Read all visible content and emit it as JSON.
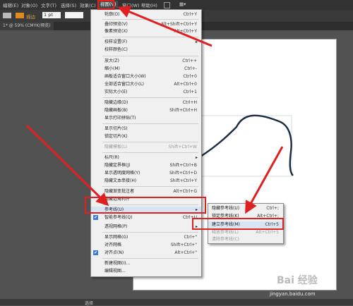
{
  "menubar": {
    "items": [
      "编辑(E)",
      "对象(O)",
      "文字(T)",
      "选择(S)",
      "效果(C)",
      "视图(V)",
      "窗口(W)",
      "帮助(H)"
    ]
  },
  "toolbar": {
    "stroke_label": "描边",
    "stroke_value": "1 pt"
  },
  "tab": {
    "label": "1* @ 59% (CMYK/预览)"
  },
  "view_menu": {
    "items": [
      {
        "label": "轮廓(O)",
        "shortcut": "Ctrl+Y"
      },
      {
        "label": "叠印预览(V)",
        "shortcut": "Alt+Shift+Ctrl+Y"
      },
      {
        "label": "像素预览(X)",
        "shortcut": "Alt+Ctrl+Y"
      },
      {
        "label": "校样设置(F)",
        "shortcut": ""
      },
      {
        "label": "校样颜色(C)",
        "shortcut": ""
      },
      {
        "label": "放大(Z)",
        "shortcut": "Ctrl++"
      },
      {
        "label": "缩小(M)",
        "shortcut": "Ctrl+-"
      },
      {
        "label": "画板适合窗口大小(W)",
        "shortcut": "Ctrl+0"
      },
      {
        "label": "全部适合窗口大小(L)",
        "shortcut": "Alt+Ctrl+0"
      },
      {
        "label": "实际大小(E)",
        "shortcut": "Ctrl+1"
      },
      {
        "label": "隐藏边缘(D)",
        "shortcut": "Ctrl+H"
      },
      {
        "label": "隐藏画板(B)",
        "shortcut": "Shift+Ctrl+H"
      },
      {
        "label": "显示打印拼贴(T)",
        "shortcut": ""
      },
      {
        "label": "显示切片(S)",
        "shortcut": ""
      },
      {
        "label": "锁定切片(K)",
        "shortcut": ""
      },
      {
        "label": "隐藏模板(L)",
        "shortcut": "Shift+Ctrl+W"
      },
      {
        "label": "标尺(R)",
        "shortcut": ""
      },
      {
        "label": "隐藏定界框(J)",
        "shortcut": "Shift+Ctrl+B"
      },
      {
        "label": "显示透明度网格(Y)",
        "shortcut": "Shift+Ctrl+D"
      },
      {
        "label": "隐藏文本串接(H)",
        "shortcut": "Shift+Ctrl+Y"
      },
      {
        "label": "隐藏渐变批注者",
        "shortcut": "Alt+Ctrl+G"
      },
      {
        "label": "隐藏边角构件",
        "shortcut": ""
      },
      {
        "label": "参考线(U)",
        "shortcut": ""
      },
      {
        "label": "智能参考线(Q)",
        "shortcut": "Ctrl+U"
      },
      {
        "label": "透视网格(P)",
        "shortcut": ""
      },
      {
        "label": "显示网格(G)",
        "shortcut": "Ctrl+\""
      },
      {
        "label": "对齐网格",
        "shortcut": "Shift+Ctrl+\""
      },
      {
        "label": "对齐点(N)",
        "shortcut": "Alt+Ctrl+\""
      },
      {
        "label": "新建视图(I)...",
        "shortcut": ""
      },
      {
        "label": "编辑视图...",
        "shortcut": ""
      }
    ]
  },
  "guides_submenu": {
    "items": [
      {
        "label": "隐藏参考线(U)",
        "shortcut": "Ctrl+;"
      },
      {
        "label": "锁定参考线(K)",
        "shortcut": "Alt+Ctrl+;"
      },
      {
        "label": "建立参考线(M)",
        "shortcut": "Ctrl+5"
      },
      {
        "label": "释放参考线(L)",
        "shortcut": "Alt+Ctrl+5"
      },
      {
        "label": "清除参考线(C)",
        "shortcut": ""
      }
    ]
  },
  "statusbar": {
    "tool": "选择"
  },
  "watermark": {
    "brand": "Bai 经验",
    "url": "jingyan.baidu.com"
  }
}
